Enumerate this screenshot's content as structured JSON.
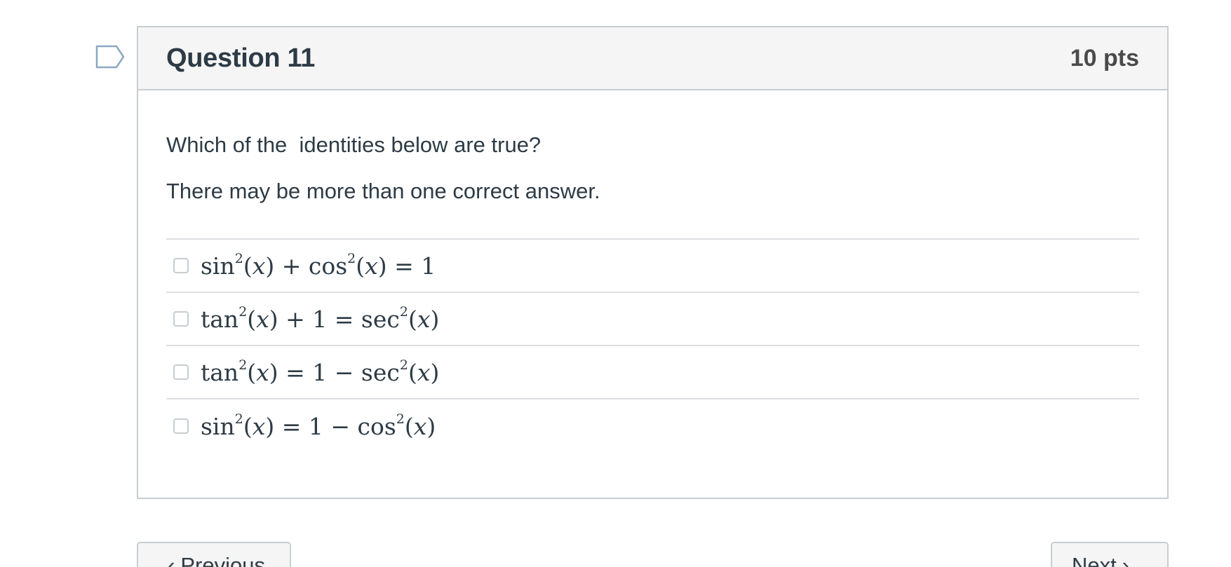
{
  "question": {
    "title": "Question 11",
    "points": "10 pts",
    "text": "Which of the  identities below are true?",
    "subtext": "There may be more than one correct answer.",
    "flag_icon": "flag-outline-icon",
    "answers": [
      {
        "parts": [
          {
            "t": "sin"
          },
          {
            "sup": "2"
          },
          {
            "t": "("
          },
          {
            "v": "x"
          },
          {
            "t": ") + cos"
          },
          {
            "sup": "2"
          },
          {
            "t": "("
          },
          {
            "v": "x"
          },
          {
            "t": ") = 1"
          }
        ],
        "checked": false
      },
      {
        "parts": [
          {
            "t": "tan"
          },
          {
            "sup": "2"
          },
          {
            "t": "("
          },
          {
            "v": "x"
          },
          {
            "t": ") + 1 = sec"
          },
          {
            "sup": "2"
          },
          {
            "t": "("
          },
          {
            "v": "x"
          },
          {
            "t": ")"
          }
        ],
        "checked": false
      },
      {
        "parts": [
          {
            "t": "tan"
          },
          {
            "sup": "2"
          },
          {
            "t": "("
          },
          {
            "v": "x"
          },
          {
            "t": ") = 1 − sec"
          },
          {
            "sup": "2"
          },
          {
            "t": "("
          },
          {
            "v": "x"
          },
          {
            "t": ")"
          }
        ],
        "checked": false
      },
      {
        "parts": [
          {
            "t": "sin"
          },
          {
            "sup": "2"
          },
          {
            "t": "("
          },
          {
            "v": "x"
          },
          {
            "t": ") = 1 − cos"
          },
          {
            "sup": "2"
          },
          {
            "t": "("
          },
          {
            "v": "x"
          },
          {
            "t": ")"
          }
        ],
        "checked": false
      }
    ]
  },
  "nav": {
    "previous_label": "Previous",
    "next_label": "Next"
  },
  "colors": {
    "text": "#2d3b45",
    "border": "#c7cdd1",
    "header_bg": "#f5f5f5",
    "flag": "#8ea7c4"
  }
}
